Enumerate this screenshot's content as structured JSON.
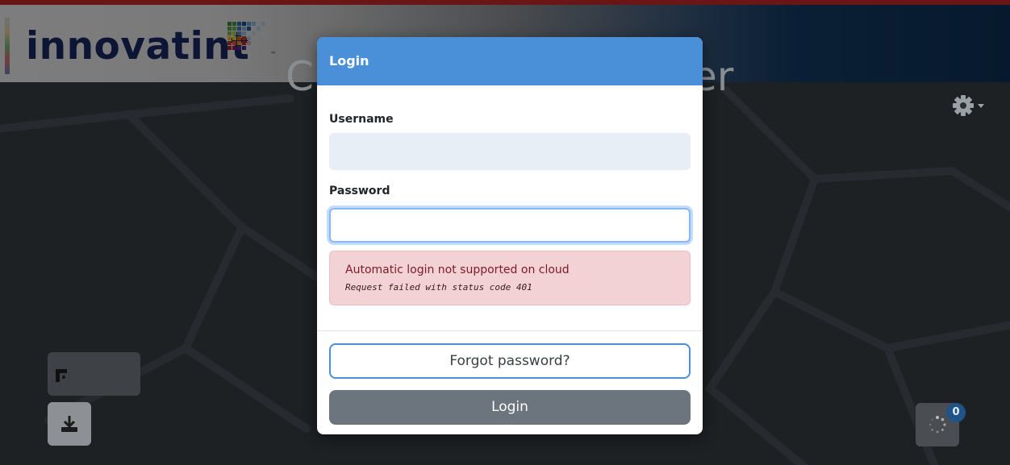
{
  "brand": {
    "logo_text": "innovatint",
    "tm": "™"
  },
  "background": {
    "title_left": "C",
    "title_right": "er"
  },
  "modal": {
    "title": "Login",
    "username_label": "Username",
    "username_value": "",
    "password_label": "Password",
    "password_value": "",
    "alert_message": "Automatic login not supported on cloud",
    "alert_detail": "Request failed with status code 401",
    "forgot_label": "Forgot password?",
    "login_label": "Login"
  },
  "jobs": {
    "count": "0"
  },
  "colors": {
    "header_accent": "#4a90d9",
    "alert_bg": "#f3d2d5",
    "alert_text": "#7d1a24",
    "login_button": "#6c757d",
    "badge": "#1e5488"
  },
  "icons": [
    "gear-icon",
    "caret-down-icon",
    "tinting-machine-icon",
    "download-icon",
    "spinner-icon"
  ]
}
